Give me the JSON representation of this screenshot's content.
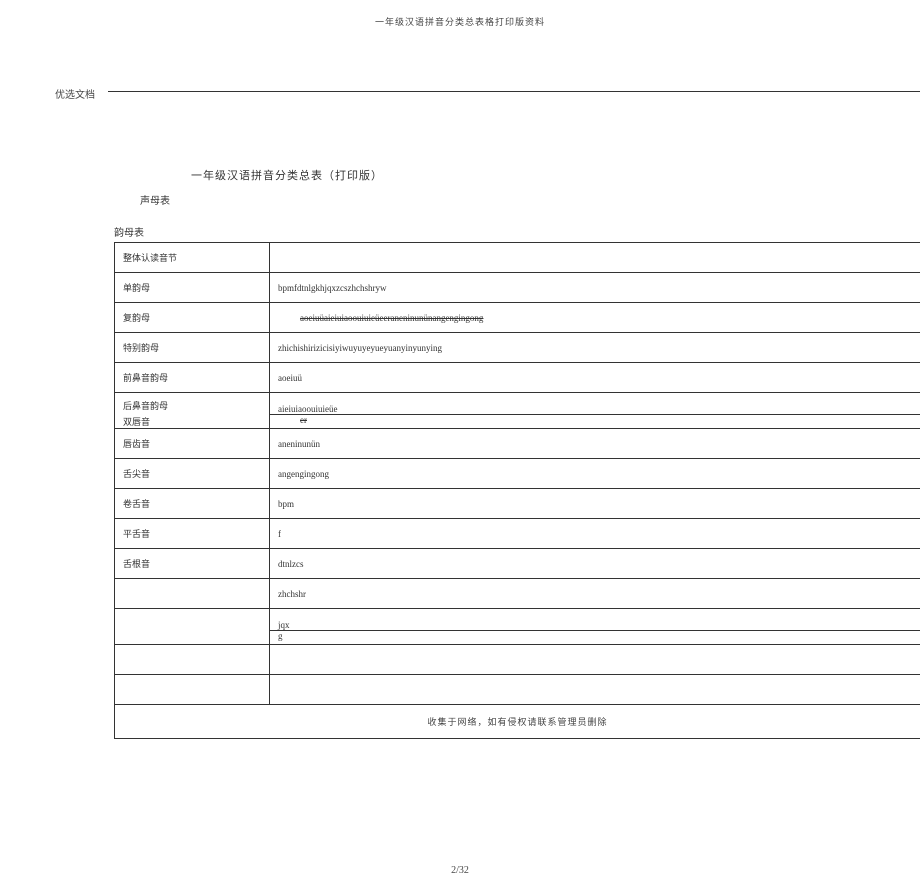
{
  "header": "一年级汉语拼音分类总表格打印版资料",
  "tag": "优选文档",
  "title": "一年级汉语拼音分类总表（打印版）",
  "label1": "声母表",
  "label2": "韵母表",
  "rows": [
    {
      "l": "整体认读音节",
      "v": ""
    },
    {
      "l": "单韵母",
      "v": "bpmfdtnlgkhjqxzcszhchshryw"
    },
    {
      "l": "复韵母",
      "v": "aoeiuüaieiuiaoouiuieüeeraneninunünangengingong",
      "strike": true,
      "indent": true
    },
    {
      "l": "特别韵母",
      "v": "zhichishirizicisiyiwuyuyeyueyuanyinyunying"
    },
    {
      "l": "前鼻音韵母",
      "v": "aoeiuü"
    },
    {
      "l": "后鼻音韵母",
      "v": "aieiuiaoouiuieüe",
      "halfUpper": true
    },
    {
      "l": "双唇音",
      "v": "er",
      "strike": true,
      "halfLower": true,
      "indent": true
    },
    {
      "l": "唇齿音",
      "v": "aneninunün"
    },
    {
      "l": "舌尖音",
      "v": "angengingong"
    },
    {
      "l": "卷舌音",
      "v": "bpm"
    },
    {
      "l": "平舌音",
      "v": "f"
    },
    {
      "l": "舌根音",
      "v": "dtnlzcs"
    },
    {
      "l": "",
      "v": "zhchshr"
    },
    {
      "l": "",
      "v": "jqx",
      "halfUpper": true
    },
    {
      "l": "",
      "v": "g",
      "halfLower": true
    },
    {
      "l": "",
      "v": ""
    },
    {
      "l": "",
      "v": ""
    }
  ],
  "footerNote": "收集于网络，如有侵权请联系管理员删除",
  "pageNumber": "2/32"
}
